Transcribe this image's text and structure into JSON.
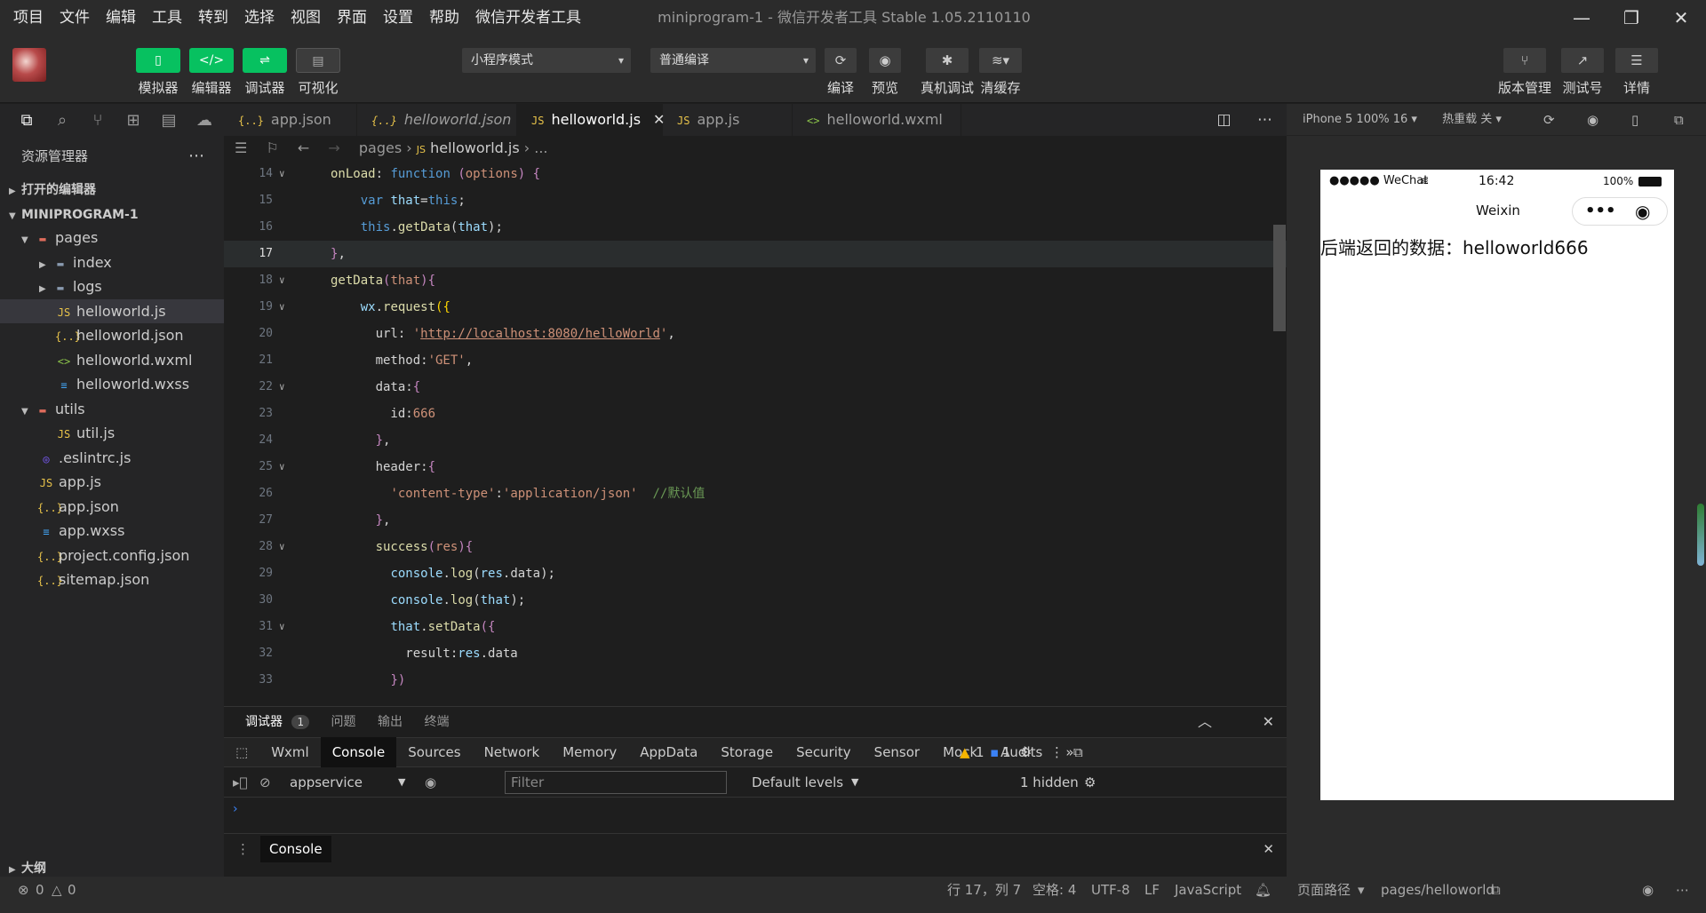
{
  "menubar": {
    "items": [
      "项目",
      "文件",
      "编辑",
      "工具",
      "转到",
      "选择",
      "视图",
      "界面",
      "设置",
      "帮助",
      "微信开发者工具"
    ],
    "title": "miniprogram-1 - 微信开发者工具 Stable 1.05.2110110"
  },
  "toolbar": {
    "simulator_label": "模拟器",
    "editor_label": "编辑器",
    "debugger_label": "调试器",
    "visual_label": "可视化",
    "mode_select": "小程序模式",
    "compile_select": "普通编译",
    "compile_label": "编译",
    "preview_label": "预览",
    "remote_debug_label": "真机调试",
    "clear_cache_label": "清缓存",
    "version_label": "版本管理",
    "test_label": "测试号",
    "details_label": "详情"
  },
  "sidebar": {
    "title": "资源管理器",
    "open_editors": "打开的编辑器",
    "project": "MINIPROGRAM-1",
    "tree": [
      {
        "label": "pages",
        "type": "folder-open",
        "depth": 1
      },
      {
        "label": "index",
        "type": "folder",
        "depth": 2
      },
      {
        "label": "logs",
        "type": "folder",
        "depth": 2
      },
      {
        "label": "helloworld.js",
        "type": "js",
        "depth": 2,
        "selected": true
      },
      {
        "label": "helloworld.json",
        "type": "json",
        "depth": 2
      },
      {
        "label": "helloworld.wxml",
        "type": "wxml",
        "depth": 2
      },
      {
        "label": "helloworld.wxss",
        "type": "wxss",
        "depth": 2
      },
      {
        "label": "utils",
        "type": "folder-open",
        "depth": 1
      },
      {
        "label": "util.js",
        "type": "js",
        "depth": 2
      },
      {
        "label": ".eslintrc.js",
        "type": "eslint",
        "depth": 1
      },
      {
        "label": "app.js",
        "type": "js",
        "depth": 1
      },
      {
        "label": "app.json",
        "type": "json",
        "depth": 1
      },
      {
        "label": "app.wxss",
        "type": "wxss",
        "depth": 1
      },
      {
        "label": "project.config.json",
        "type": "json",
        "depth": 1
      },
      {
        "label": "sitemap.json",
        "type": "json",
        "depth": 1
      }
    ],
    "outline": "大纲"
  },
  "tabs": [
    {
      "label": "app.json",
      "icon": "{..}"
    },
    {
      "label": "helloworld.json",
      "icon": "{..}",
      "italic": true
    },
    {
      "label": "helloworld.js",
      "icon": "JS",
      "active": true
    },
    {
      "label": "app.js",
      "icon": "JS"
    },
    {
      "label": "helloworld.wxml",
      "icon": "<>"
    }
  ],
  "breadcrumb": {
    "folder": "pages",
    "file": "helloworld.js",
    "rest": "..."
  },
  "editor": {
    "current_line": 17,
    "line_numbers": [
      "14",
      "15",
      "16",
      "17",
      "18",
      "19",
      "20",
      "21",
      "22",
      "23",
      "24",
      "25",
      "26",
      "27",
      "28",
      "29",
      "30",
      "31",
      "32",
      "33"
    ]
  },
  "debugger": {
    "tab_debugger": "调试器",
    "badge": "1",
    "tab_problems": "问题",
    "tab_output": "输出",
    "tab_terminal": "终端",
    "devtools_tabs": [
      "Wxml",
      "Console",
      "Sources",
      "Network",
      "Memory",
      "AppData",
      "Storage",
      "Security",
      "Sensor",
      "Mock",
      "Audits"
    ],
    "warn_count": "1",
    "msg_count": "1",
    "context": "appservice",
    "filter_placeholder": "Filter",
    "levels": "Default levels",
    "hidden": "1 hidden",
    "drawer_tab": "Console"
  },
  "simulator": {
    "device": "iPhone 5 100% 16",
    "hot_reload": "热重载 关",
    "carrier": "●●●●● WeChat",
    "time": "16:42",
    "battery": "100%",
    "nav_title": "Weixin",
    "content": "后端返回的数据：helloworld666"
  },
  "statusbar": {
    "errors": "0",
    "warnings": "0",
    "position": "行 17，列 7",
    "spaces": "空格: 4",
    "encoding": "UTF-8",
    "eol": "LF",
    "language": "JavaScript",
    "page_path_label": "页面路径",
    "page_path": "pages/helloworld"
  }
}
